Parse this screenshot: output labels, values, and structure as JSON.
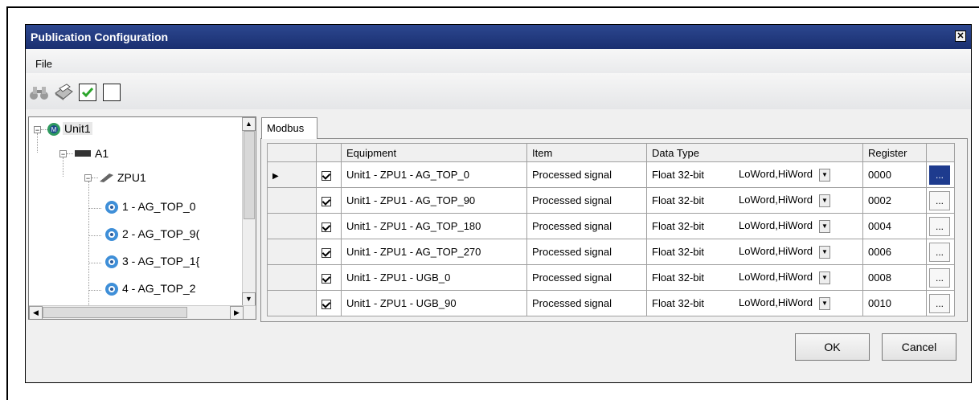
{
  "window": {
    "title": "Publication Configuration",
    "close_icon": "close-icon"
  },
  "menu": {
    "file": "File"
  },
  "toolbar": {
    "icons": [
      "binoculars-icon",
      "printer-icon",
      "check-all-icon",
      "uncheck-all-icon"
    ]
  },
  "tree": {
    "root": "Unit1",
    "child": "A1",
    "grandchild": "ZPU1",
    "leaves": [
      "1 - AG_TOP_0",
      "2 - AG_TOP_9(",
      "3 - AG_TOP_1{",
      "4 - AG_TOP_2"
    ]
  },
  "tab": {
    "label": "Modbus"
  },
  "grid": {
    "columns": [
      "",
      "",
      "Equipment",
      "Item",
      "Data Type",
      "",
      "Register",
      ""
    ],
    "rows": [
      {
        "equipment": "Unit1 - ZPU1 - AG_TOP_0",
        "item": "Processed signal",
        "type": "Float 32-bit",
        "order": "LoWord,HiWord",
        "register": "0000",
        "selected": true
      },
      {
        "equipment": "Unit1 - ZPU1 - AG_TOP_90",
        "item": "Processed signal",
        "type": "Float 32-bit",
        "order": "LoWord,HiWord",
        "register": "0002",
        "selected": false
      },
      {
        "equipment": "Unit1 - ZPU1 - AG_TOP_180",
        "item": "Processed signal",
        "type": "Float 32-bit",
        "order": "LoWord,HiWord",
        "register": "0004",
        "selected": false
      },
      {
        "equipment": "Unit1 - ZPU1 - AG_TOP_270",
        "item": "Processed signal",
        "type": "Float 32-bit",
        "order": "LoWord,HiWord",
        "register": "0006",
        "selected": false
      },
      {
        "equipment": "Unit1 - ZPU1 - UGB_0",
        "item": "Processed signal",
        "type": "Float 32-bit",
        "order": "LoWord,HiWord",
        "register": "0008",
        "selected": false
      },
      {
        "equipment": "Unit1 - ZPU1 - UGB_90",
        "item": "Processed signal",
        "type": "Float 32-bit",
        "order": "LoWord,HiWord",
        "register": "0010",
        "selected": false
      }
    ],
    "ellipsis": "..."
  },
  "buttons": {
    "ok": "OK",
    "cancel": "Cancel"
  },
  "colors": {
    "titlebar": "#1a2f70",
    "selected_cell": "#1e3b8e"
  }
}
